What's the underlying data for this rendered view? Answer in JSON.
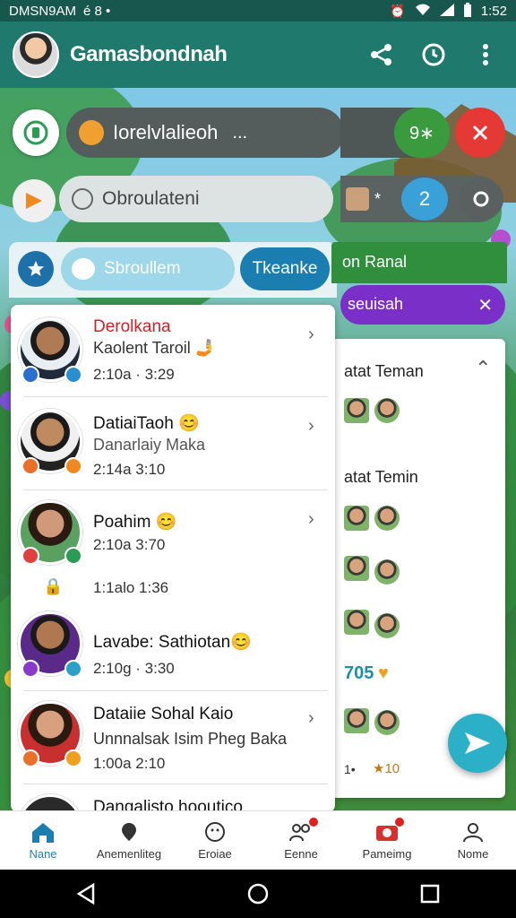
{
  "status_bar": {
    "left_text": "DMSN9AM",
    "left_icons": "é 8 •",
    "right_time": "1:52"
  },
  "app_bar": {
    "title": "Gamasbondnah"
  },
  "top_pills": {
    "pill1_label": "Iorelvlalieoh",
    "pill1_dots": "...",
    "pill1_badge": "9∗",
    "pill2_label": "Obroulateni",
    "pill2_number": "2",
    "pill2_side_mark": "*"
  },
  "search_row": {
    "search_label": "Sbroullem",
    "button_label": "Tkeanke"
  },
  "right_panel": {
    "green_label": "on Ranal",
    "purple_label": "seuisah",
    "header1": "atat Teman",
    "header2": "atat Temin",
    "stat1": "705",
    "stat2_prefix": "1•",
    "stat2": "★10"
  },
  "chats": [
    {
      "name": "Derolkana",
      "sub": "Kaolent Taroil 🤳",
      "time": "2:10a · 3:29"
    },
    {
      "name": "DatiaiTaoh 😊",
      "sub": "Danarlaiy Maka",
      "time": "2:14a 3:10"
    },
    {
      "name": "Poahim 😊",
      "sub": "",
      "time": "2:10a 3:70",
      "extra_time": "1:1alo 1:36"
    },
    {
      "name": "Lavabe: Sathiotan😊",
      "sub": "",
      "time": "2:10g · 3:30"
    },
    {
      "name": "Dataiie Sohal Kaio",
      "sub": "Unnnalsak Isim Pheg Baka",
      "time": "1:00a 2:10"
    },
    {
      "name": "Dangalisto hooutico",
      "sub": "",
      "time": ""
    }
  ],
  "bottom_nav": [
    {
      "label": "Nane",
      "icon": "home-icon"
    },
    {
      "label": "Anemenliteg",
      "icon": "location-icon"
    },
    {
      "label": "Eroiae",
      "icon": "smiley-icon"
    },
    {
      "label": "Eenne",
      "icon": "group-icon"
    },
    {
      "label": "Pameimg",
      "icon": "camera-icon"
    },
    {
      "label": "Nome",
      "icon": "person-icon"
    }
  ],
  "colors": {
    "app_bar": "#1f7a6d",
    "accent": "#1e8fa8",
    "nav_active": "#1a7fb0"
  }
}
